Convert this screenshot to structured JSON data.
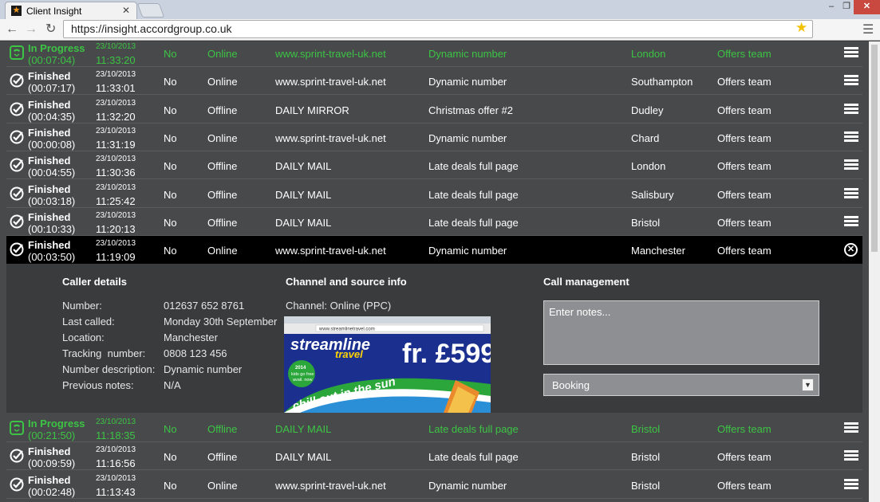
{
  "browser": {
    "tab_title": "Client Insight",
    "tab_close": "✕",
    "url": "https://insight.accordgroup.co.uk",
    "min": "‒",
    "max": "❐",
    "close": "✕"
  },
  "rows_top": [
    {
      "status": "In Progress",
      "duration": "(00:07:04)",
      "date": "23/10/2013",
      "time": "11:33:20",
      "no": "No",
      "channel": "Online",
      "source": "www.sprint-travel-uk.net",
      "description": "Dynamic number",
      "location": "London",
      "team": "Offers team",
      "state": "progress"
    },
    {
      "status": "Finished",
      "duration": "(00:07:17)",
      "date": "23/10/2013",
      "time": "11:33:01",
      "no": "No",
      "channel": "Online",
      "source": "www.sprint-travel-uk.net",
      "description": "Dynamic number",
      "location": "Southampton",
      "team": "Offers team",
      "state": "finished"
    },
    {
      "status": "Finished",
      "duration": "(00:04:35)",
      "date": "23/10/2013",
      "time": "11:32:20",
      "no": "No",
      "channel": "Offline",
      "source": "DAILY MIRROR",
      "description": "Christmas offer #2",
      "location": "Dudley",
      "team": "Offers team",
      "state": "finished"
    },
    {
      "status": "Finished",
      "duration": "(00:00:08)",
      "date": "23/10/2013",
      "time": "11:31:19",
      "no": "No",
      "channel": "Online",
      "source": "www.sprint-travel-uk.net",
      "description": "Dynamic number",
      "location": "Chard",
      "team": "Offers team",
      "state": "finished"
    },
    {
      "status": "Finished",
      "duration": "(00:04:55)",
      "date": "23/10/2013",
      "time": "11:30:36",
      "no": "No",
      "channel": "Offline",
      "source": "DAILY MAIL",
      "description": "Late deals full page",
      "location": "London",
      "team": "Offers team",
      "state": "finished"
    },
    {
      "status": "Finished",
      "duration": "(00:03:18)",
      "date": "23/10/2013",
      "time": "11:25:42",
      "no": "No",
      "channel": "Offline",
      "source": "DAILY MAIL",
      "description": "Late deals full page",
      "location": "Salisbury",
      "team": "Offers team",
      "state": "finished"
    },
    {
      "status": "Finished",
      "duration": "(00:10:33)",
      "date": "23/10/2013",
      "time": "11:20:13",
      "no": "No",
      "channel": "Offline",
      "source": "DAILY MAIL",
      "description": "Late deals full page",
      "location": "Bristol",
      "team": "Offers team",
      "state": "finished"
    },
    {
      "status": "Finished",
      "duration": "(00:03:50)",
      "date": "23/10/2013",
      "time": "11:19:09",
      "no": "No",
      "channel": "Online",
      "source": "www.sprint-travel-uk.net",
      "description": "Dynamic number",
      "location": "Manchester",
      "team": "Offers team",
      "state": "selected"
    }
  ],
  "detail": {
    "caller_heading": "Caller details",
    "channel_heading": "Channel and source info",
    "call_heading": "Call management",
    "labels": {
      "number": "Number:",
      "last_called": "Last called:",
      "location": "Location:",
      "tracking": "Tracking  number:",
      "description": "Number description:",
      "notes": "Previous notes:"
    },
    "values": {
      "number": "012637 652 8761",
      "last_called": "Monday 30th September",
      "location": "Manchester",
      "tracking": "0808 123 456",
      "description": "Dynamic number",
      "notes": "N/A"
    },
    "channel": "Channel: Online (PPC)",
    "ad": {
      "url": "www.streamlinetravel.com",
      "brand1": "streamline",
      "brand2": "travel",
      "price": "fr. £599",
      "badge_year": "2014",
      "badge_line1": "kids go free",
      "badge_line2": "avail. now",
      "tagline": "chill out in the sun"
    },
    "notes_placeholder": "Enter notes...",
    "booking_value": "Booking"
  },
  "rows_bottom": [
    {
      "status": "In Progress",
      "duration": "(00:21:50)",
      "date": "23/10/2013",
      "time": "11:18:35",
      "no": "No",
      "channel": "Offline",
      "source": "DAILY MAIL",
      "description": "Late deals full page",
      "location": "Bristol",
      "team": "Offers team",
      "state": "progress"
    },
    {
      "status": "Finished",
      "duration": "(00:09:59)",
      "date": "23/10/2013",
      "time": "11:16:56",
      "no": "No",
      "channel": "Offline",
      "source": "DAILY MAIL",
      "description": "Late deals full page",
      "location": "Bristol",
      "team": "Offers team",
      "state": "finished"
    },
    {
      "status": "Finished",
      "duration": "(00:02:48)",
      "date": "23/10/2013",
      "time": "11:13:43",
      "no": "No",
      "channel": "Online",
      "source": "www.sprint-travel-uk.net",
      "description": "Dynamic number",
      "location": "Bristol",
      "team": "Offers team",
      "state": "finished"
    }
  ],
  "colors": {
    "in_progress": "#3cc444",
    "finished": "#ffffff",
    "selected_bg": "#000000",
    "panel_bg": "#3a3b3d",
    "page_bg": "#48494b"
  },
  "icons": {
    "finished": "check-circle-icon",
    "in_progress": "phone-active-icon",
    "row_menu": "hamburger-icon",
    "row_close": "close-circle-icon"
  }
}
